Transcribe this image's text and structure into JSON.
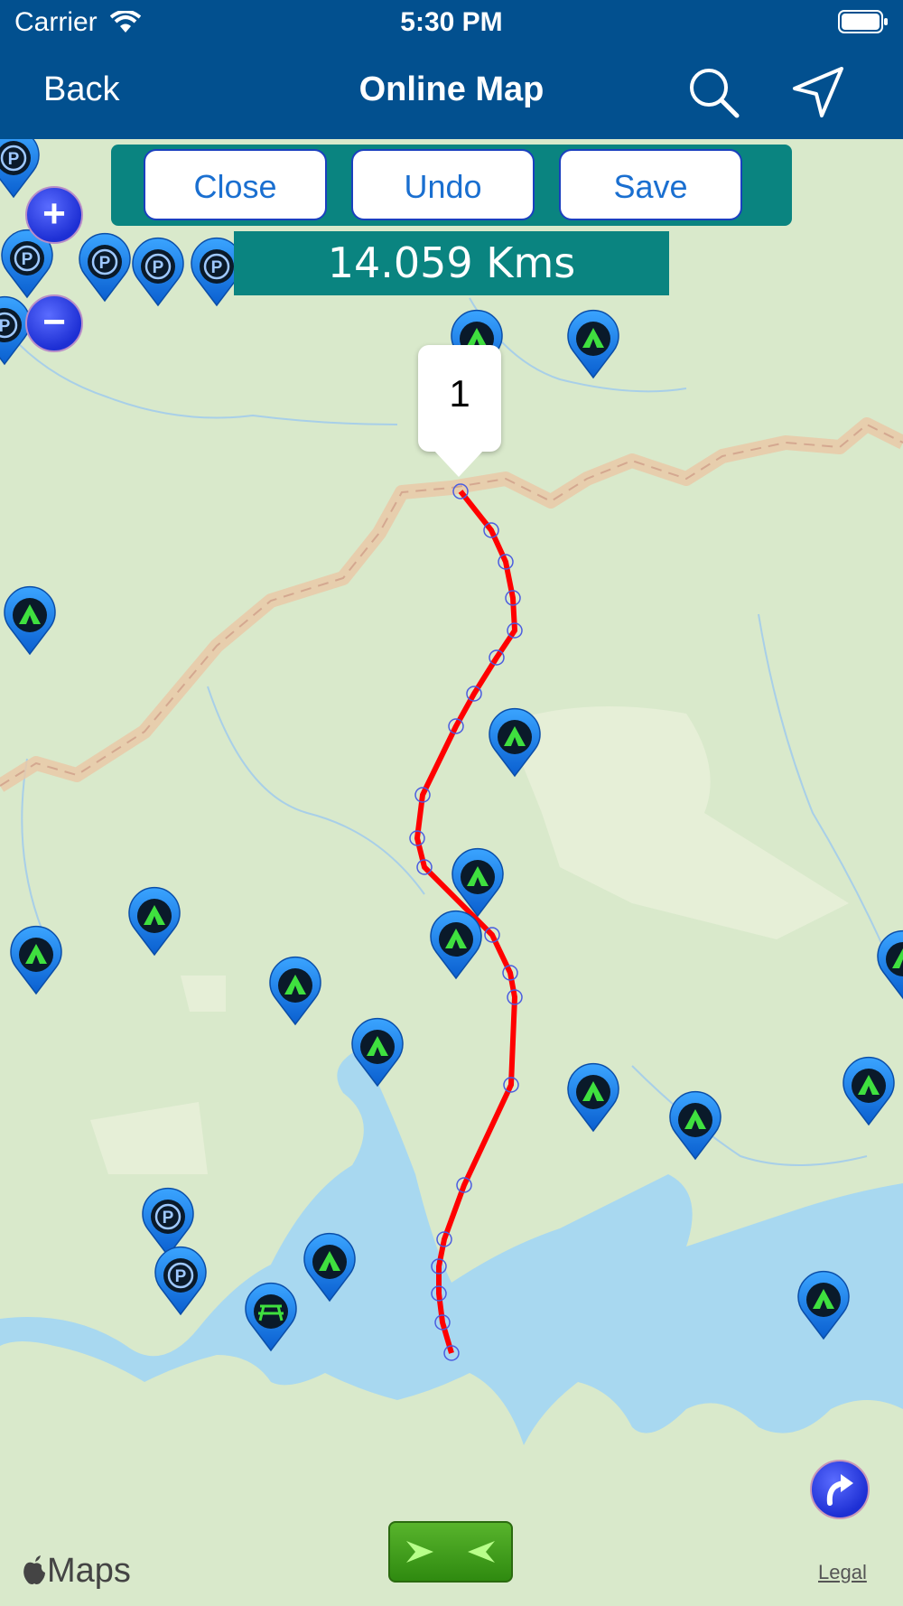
{
  "status_bar": {
    "carrier": "Carrier",
    "time": "5:30 PM"
  },
  "nav": {
    "back_label": "Back",
    "title": "Online Map",
    "search_icon": "search-icon",
    "location_icon": "location-arrow-icon"
  },
  "toolbar": {
    "close_label": "Close",
    "undo_label": "Undo",
    "save_label": "Save"
  },
  "distance": "14.059 Kms",
  "callout_label": "1",
  "footer": {
    "maps_label": "Maps",
    "legal_label": "Legal"
  },
  "colors": {
    "nav_bg": "#02508f",
    "toolbar_bg": "#0a8480",
    "route": "#ff0000",
    "map_bg": "#d9e9cb",
    "water": "#a8d8f0",
    "pin_blue": "#1c82e0",
    "tent_green": "#3fe03f"
  }
}
